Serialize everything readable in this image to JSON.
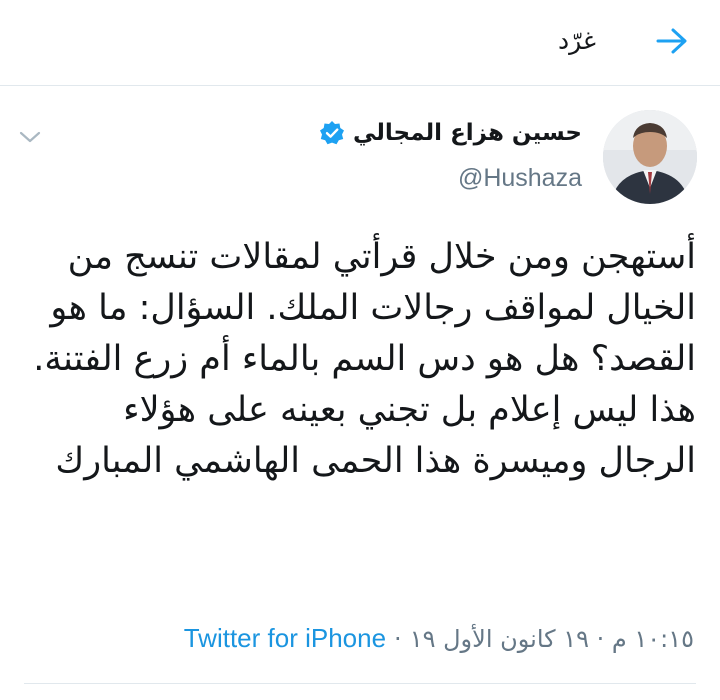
{
  "header": {
    "title": "غرّد",
    "back_icon": "arrow-right-icon"
  },
  "tweet": {
    "author_name": "حسين هزاع المجالي",
    "handle": "@Hushaza",
    "verified": true,
    "text": "أستهجن ومن خلال قرأتي لمقالات تنسج من الخيال لمواقف رجالات الملك. السؤال: ما هو القصد؟ هل هو دس السم بالماء أم زرع الفتنة. هذا ليس إعلام بل تجني بعينه على هؤلاء الرجال وميسرة هذا الحمى الهاشمي المبارك",
    "timestamp": "١٠:١٥ م · ١٩ كانون الأول ١٩",
    "separator": "·",
    "source": "Twitter for iPhone"
  },
  "colors": {
    "accent": "#1da1f2",
    "link": "#1b95e0",
    "text_primary": "#14171a",
    "text_secondary": "#657786",
    "divider": "#e1e8ed"
  }
}
